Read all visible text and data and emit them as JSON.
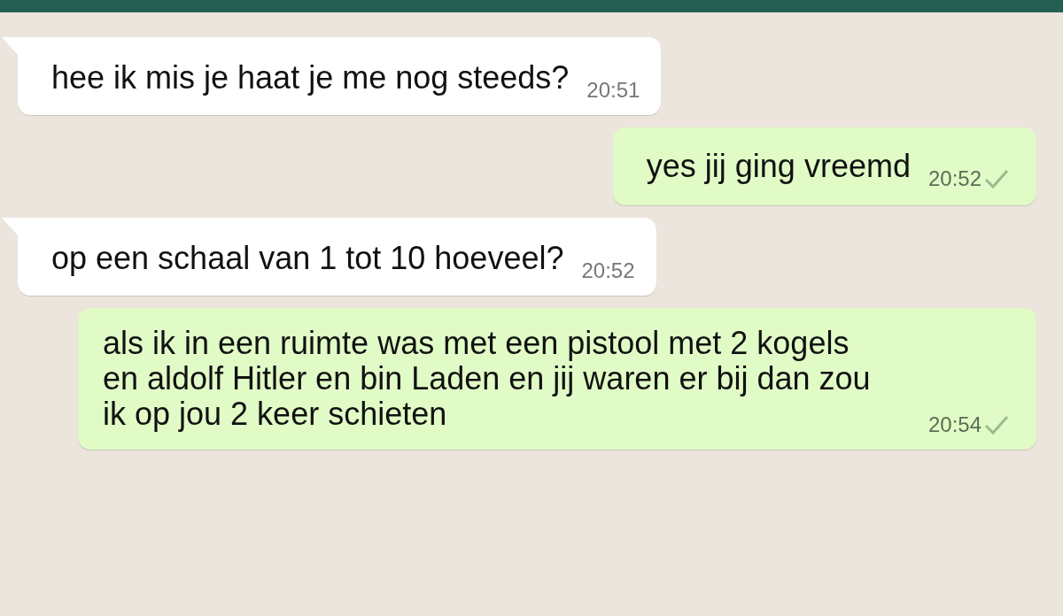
{
  "messages": [
    {
      "kind": "incoming",
      "text": "hee ik mis je haat je me nog steeds?",
      "time": "20:51",
      "sent": false
    },
    {
      "kind": "outgoing",
      "text": "yes jij ging vreemd",
      "time": "20:52",
      "sent": true
    },
    {
      "kind": "incoming",
      "text": "op een schaal van 1 tot 10 hoeveel?",
      "time": "20:52",
      "sent": false
    },
    {
      "kind": "outgoing",
      "text": "als ik in een ruimte was met een pistool met 2 kogels en aldolf Hitler en bin Laden en jij waren er bij dan zou ik op jou 2 keer schieten",
      "time": "20:54",
      "sent": true
    }
  ]
}
